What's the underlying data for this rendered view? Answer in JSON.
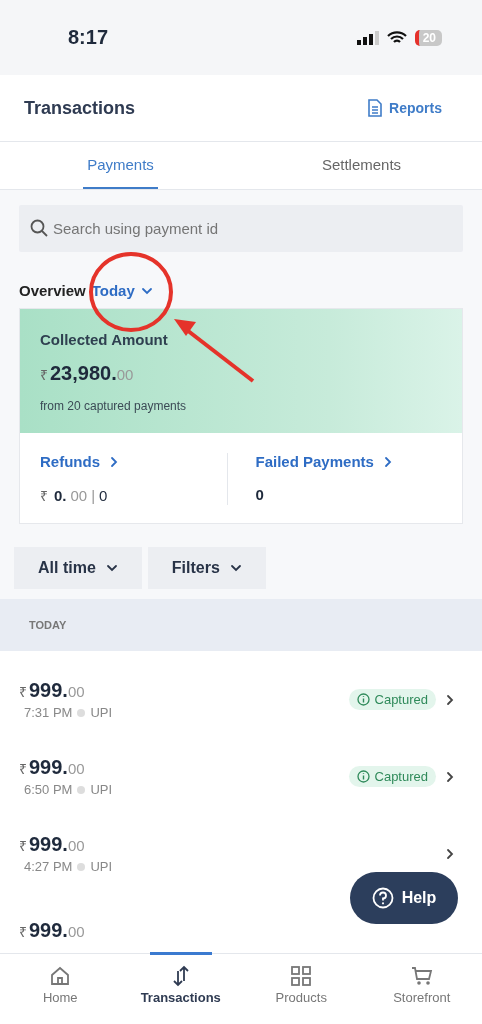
{
  "status_bar": {
    "time": "8:17",
    "battery": "20"
  },
  "header": {
    "title": "Transactions",
    "action": "Reports"
  },
  "tabs": [
    {
      "label": "Payments",
      "selected": true
    },
    {
      "label": "Settlements",
      "selected": false
    }
  ],
  "search": {
    "placeholder": "Search using payment id"
  },
  "overview": {
    "label": "Overview",
    "period": "Today"
  },
  "collected": {
    "title": "Collected Amount",
    "currency": "₹",
    "whole": "23,980.",
    "decimals": "00",
    "note": "from 20 captured payments"
  },
  "refunds": {
    "title": "Refunds",
    "currency": "₹",
    "whole": "0.",
    "decimals": "00",
    "separator": "|",
    "count": "0"
  },
  "failed": {
    "title": "Failed Payments",
    "count": "0"
  },
  "filters": [
    "All time",
    "Filters"
  ],
  "section": "TODAY",
  "payments": [
    {
      "currency": "₹",
      "whole": "999.",
      "decimals": "00",
      "time": "7:31 PM",
      "method": "UPI",
      "status": "Captured"
    },
    {
      "currency": "₹",
      "whole": "999.",
      "decimals": "00",
      "time": "6:50 PM",
      "method": "UPI",
      "status": "Captured"
    },
    {
      "currency": "₹",
      "whole": "999.",
      "decimals": "00",
      "time": "4:27 PM",
      "method": "UPI"
    },
    {
      "currency": "₹",
      "whole": "999.",
      "decimals": "00"
    }
  ],
  "help": "Help",
  "nav": [
    {
      "label": "Home",
      "selected": false
    },
    {
      "label": "Transactions",
      "selected": true
    },
    {
      "label": "Products",
      "selected": false
    },
    {
      "label": "Storefront",
      "selected": false
    }
  ]
}
